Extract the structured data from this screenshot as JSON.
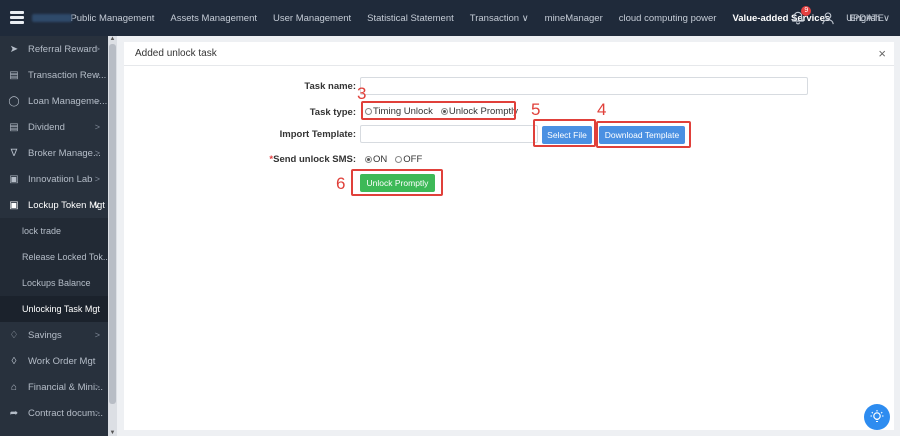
{
  "topbar": {
    "menu": [
      "Public Management",
      "Assets Management",
      "User Management",
      "Statistical Statement",
      "Transaction ∨",
      "mineManager",
      "cloud computing power",
      "Value-added Services",
      "UPDATE"
    ],
    "active_menu": "Value-added Services",
    "notification_count": "9",
    "language": "English ∨"
  },
  "sidebar": {
    "items": [
      {
        "label": "Referral Reward",
        "icon": "send-icon"
      },
      {
        "label": "Transaction Rew...",
        "icon": "bar-chart-icon"
      },
      {
        "label": "Loan Manageme...",
        "icon": "loan-icon"
      },
      {
        "label": "Dividend",
        "icon": "document-icon"
      },
      {
        "label": "Broker Manage...",
        "icon": "cart-icon"
      },
      {
        "label": "Innovatiion Lab",
        "icon": "lab-icon"
      },
      {
        "label": "Lockup Token Mgt",
        "icon": "lock-icon"
      }
    ],
    "subitems": [
      "lock trade",
      "Release Locked Tok...",
      "Lockups Balance",
      "Unlocking Task Mgt"
    ],
    "active_subitem": "Unlocking Task Mgt",
    "items_after": [
      {
        "label": "Savings",
        "icon": "diamond-icon"
      },
      {
        "label": "Work Order Mgt",
        "icon": "tag-icon"
      },
      {
        "label": "Financial & Mini...",
        "icon": "bank-icon"
      },
      {
        "label": "Contract docum...",
        "icon": "share-icon"
      }
    ]
  },
  "panel": {
    "title": "Added unlock task",
    "task_name_label": "Task name:",
    "task_name_value": "",
    "task_type_label": "Task type:",
    "task_type_options": [
      "Timing Unlock",
      "Unlock Promptly"
    ],
    "task_type_selected": "Unlock Promptly",
    "import_label": "Import Template:",
    "import_value": "",
    "select_file_label": "Select File",
    "download_template_label": "Download Template",
    "sms_required_mark": "*",
    "sms_label": "Send unlock SMS:",
    "sms_options": [
      "ON",
      "OFF"
    ],
    "sms_selected": "ON",
    "submit_label": "Unlock Promptly"
  },
  "annotations": [
    "3",
    "5",
    "4",
    "6"
  ],
  "colors": {
    "primary_button": "#4a90e2",
    "submit_button": "#3db957",
    "annotation": "#e0403a",
    "nav_bg": "#1f2a3a",
    "sidebar_bg": "#28313d"
  }
}
